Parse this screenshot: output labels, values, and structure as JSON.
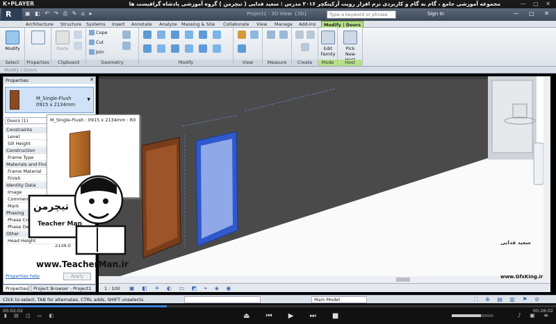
{
  "player": {
    "logo": "K•PLAYER",
    "title": "مجموعه آموزشی جامع ، گام به گام و کاربردی نرم افزار رویت آرکیتکچر ۲۰۱۶ مدرس : سعید فدایی ( تیچرمن ) گروه آموزشی پادشاه گرافیست ها",
    "time_current": "00:02:02",
    "time_total": "00:26:02",
    "progress": 0.3,
    "volume": 0.7
  },
  "titlebar": {
    "doc_title": "Project1 - 3D View: {3D}",
    "search_placeholder": "Type a keyword or phrase",
    "sign_in": "Sign In"
  },
  "tabs": [
    "Architecture",
    "Structure",
    "Systems",
    "Insert",
    "Annotate",
    "Analyze",
    "Massing & Site",
    "Collaborate",
    "View",
    "Manage",
    "Add-Ins",
    "Modify | Doors"
  ],
  "active_tab": "Modify | Doors",
  "ribbon": {
    "modify_label": "Modify",
    "paste_label": "Paste",
    "cope": "Cope",
    "cut": "Cut",
    "join": "Join",
    "edit_family": "Edit Family",
    "pick_new_host": "Pick New Host",
    "panels": [
      "Select",
      "Properties",
      "Clipboard",
      "Geometry",
      "Modify",
      "View",
      "Measure",
      "Create",
      "Mode",
      "Host"
    ]
  },
  "context_bar": "Modify | Doors",
  "properties": {
    "header": "Properties",
    "type_name": "M_Single-Flush",
    "type_size": "0915 x 2134mm",
    "filter": "Doors (1)",
    "rows": [
      {
        "label": "Constraints",
        "group": true
      },
      {
        "label": "Level",
        "group": false
      },
      {
        "label": "Sill Height",
        "group": false
      },
      {
        "label": "Construction",
        "group": true
      },
      {
        "label": "Frame Type",
        "group": false
      },
      {
        "label": "Materials and Finis...",
        "group": true
      },
      {
        "label": "Frame Material",
        "group": false
      },
      {
        "label": "Finish",
        "group": false
      },
      {
        "label": "Identity Data",
        "group": true
      },
      {
        "label": "Image",
        "group": false
      },
      {
        "label": "Comments",
        "group": false
      },
      {
        "label": "Mark",
        "group": false
      },
      {
        "label": "Phasing",
        "group": true
      },
      {
        "label": "Phase Created",
        "group": false
      },
      {
        "label": "Phase Demolished",
        "group": false
      },
      {
        "label": "Other",
        "group": true
      },
      {
        "label": "Head Height",
        "group": false
      }
    ],
    "head_height_value": "2134.0",
    "help": "Properties help",
    "apply": "Apply"
  },
  "tooltip": "M_Single-Flush : 0915 x 2134mm : R0",
  "bottom_tabs": [
    "Properties",
    "Project Browser - Project1"
  ],
  "view": {
    "scale": "1 : 100"
  },
  "status": {
    "text": "Click to select, TAB for alternates, CTRL adds, SHIFT unselects.",
    "model": "Main Model"
  },
  "watermark": {
    "teacherman_logo": "تیچرمن",
    "teacherman_name": "Teacher Man",
    "teacherman_url": "www.TeacherMan.ir",
    "gfx_name": "سعید فدایی",
    "gfx_url": "www.GfxKing.ir"
  },
  "colors": {
    "accent": "#b7e08a",
    "selected_door": "#3a63d8",
    "door_wood": "#8a4a23"
  }
}
